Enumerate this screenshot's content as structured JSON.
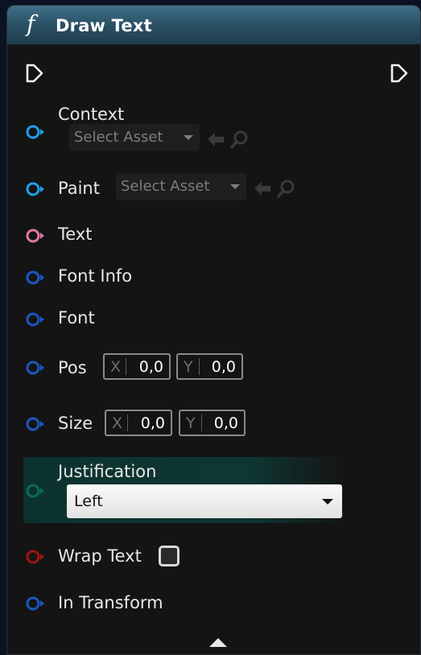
{
  "node": {
    "function_icon": "f",
    "title": "Draw Text"
  },
  "pins": {
    "context": {
      "label": "Context",
      "asset": "Select Asset"
    },
    "paint": {
      "label": "Paint",
      "asset": "Select Asset"
    },
    "text": {
      "label": "Text"
    },
    "font_info": {
      "label": "Font Info"
    },
    "font": {
      "label": "Font"
    },
    "pos": {
      "label": "Pos",
      "x_axis": "X",
      "x_value": "0,0",
      "y_axis": "Y",
      "y_value": "0,0"
    },
    "size": {
      "label": "Size",
      "x_axis": "X",
      "x_value": "0,0",
      "y_axis": "Y",
      "y_value": "0,0"
    },
    "justification": {
      "label": "Justification",
      "selected": "Left"
    },
    "wrap_text": {
      "label": "Wrap Text",
      "checked": false
    },
    "in_transform": {
      "label": "In Transform"
    }
  },
  "colors": {
    "header": "#2c5368",
    "object_pin": "#1fa0e6",
    "struct_pin": "#1a57c4",
    "string_pin": "#e07aa6",
    "enum_pin": "#0c6b55",
    "bool_pin": "#a01414",
    "node_body": "#141414"
  },
  "icons": {
    "exec_in": "exec-pin-icon",
    "exec_out": "exec-pin-icon",
    "use_selected": "arrow-left-icon",
    "browse": "magnifier-icon",
    "collapse": "triangle-up-icon"
  }
}
